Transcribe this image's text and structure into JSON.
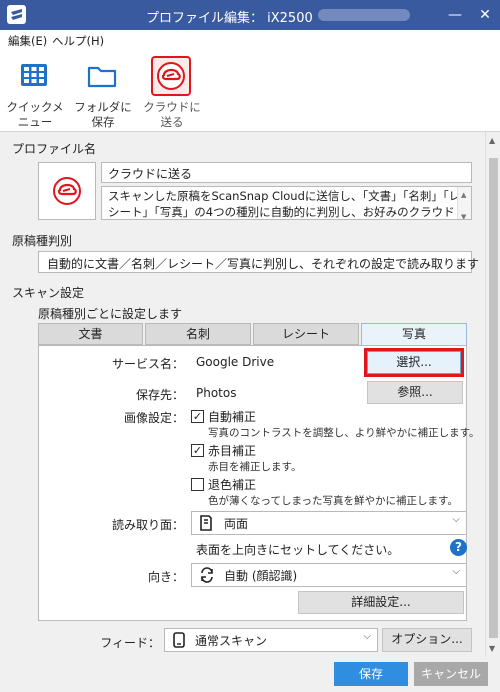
{
  "window": {
    "title": "プロファイル編集： iX2500"
  },
  "menu": {
    "edit": "編集(E)",
    "help": "ヘルプ(H)"
  },
  "toolbar": {
    "items": [
      {
        "line1": "クイックメ",
        "line2": "ニュー",
        "icon": "grid-icon"
      },
      {
        "line1": "フォルダに",
        "line2": "保存",
        "icon": "folder-icon"
      },
      {
        "line1": "クラウドに",
        "line2": "送る",
        "icon": "cloud-logo-icon"
      }
    ]
  },
  "profile": {
    "heading": "プロファイル名",
    "name": "クラウドに送る",
    "description": "スキャンした原稿をScanSnap Cloudに送信し、「文書」「名刺」「レシート」「写真」の4つの種別に自動的に判別し、お好みのクラウド"
  },
  "doc_type": {
    "heading": "原稿種判別",
    "selected": "自動的に文書／名刺／レシート／写真に判別し、それぞれの設定で読み取ります"
  },
  "scan": {
    "heading": "スキャン設定",
    "subheading": "原稿種別ごとに設定します",
    "tabs": [
      "文書",
      "名刺",
      "レシート",
      "写真"
    ],
    "active_tab": "写真",
    "service_label": "サービス名：",
    "service_value": "Google Drive",
    "select_button": "選択...",
    "dest_label": "保存先：",
    "dest_value": "Photos",
    "browse_button": "参照...",
    "image_label": "画像設定：",
    "options": [
      {
        "label": "自動補正",
        "checked": true,
        "desc": "写真のコントラストを調整し、より鮮やかに補正します。"
      },
      {
        "label": "赤目補正",
        "checked": true,
        "desc": "赤目を補正します。"
      },
      {
        "label": "退色補正",
        "checked": false,
        "desc": "色が薄くなってしまった写真を鮮やかに補正します。"
      }
    ],
    "side_label": "読み取り面：",
    "side_value": "両面",
    "side_note": "表面を上向きにセットしてください。",
    "orientation_label": "向き：",
    "orientation_value": "自動 (顔認識)",
    "detail_button": "詳細設定..."
  },
  "feed": {
    "label": "フィード：",
    "value": "通常スキャン",
    "option_button": "オプション..."
  },
  "footer": {
    "save": "保存",
    "cancel": "キャンセル"
  },
  "colors": {
    "titlebar": "#3a5aa0",
    "accent": "#e0161c",
    "primary_button": "#2f8ee0",
    "cancel_button": "#a8a8a8"
  }
}
